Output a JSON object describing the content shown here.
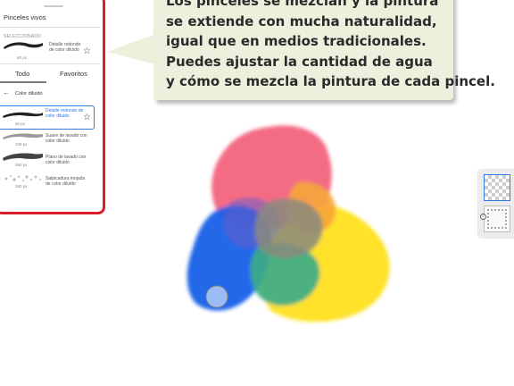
{
  "panel": {
    "title": "Pinceles vivos",
    "selected_label": "SELECCIONADO",
    "selected_brush": {
      "name": "Detalle redondo de color diluido",
      "size": "60 px"
    },
    "tabs": [
      "Todo",
      "Favoritos"
    ],
    "active_tab": "Todo",
    "breadcrumb": "Color diluido",
    "brushes": [
      {
        "name": "Detalle redondo de color diluido",
        "size": "60 px",
        "active": true
      },
      {
        "name": "Suave de lavado con color diluido",
        "size": "236 px",
        "active": false
      },
      {
        "name": "Plano de lavado con color diluido",
        "size": "360 px",
        "active": false
      },
      {
        "name": "Salpicadura mojada de color diluido",
        "size": "260 px",
        "active": false
      }
    ],
    "accent_color": "#2f79e8",
    "border_color": "#d8202a"
  },
  "callout": {
    "lines": [
      "Los pinceles se mezclan y la pintura",
      "se extiende con mucha naturalidad,",
      "igual que en medios tradicionales.",
      "Puedes ajustar la cantidad de agua",
      "y cómo se mezcla la pintura de cada pincel."
    ],
    "background": "#eef0de"
  },
  "paint_colors": {
    "pink": "#f2607a",
    "blue": "#1460e8",
    "yellow": "#ffe01c",
    "green": "#3dab86",
    "orange": "#f7a63a",
    "gray": "#8a8a7e"
  },
  "icons": {
    "star": "star-icon",
    "back": "arrow-left-icon",
    "mask": "mask-icon"
  }
}
